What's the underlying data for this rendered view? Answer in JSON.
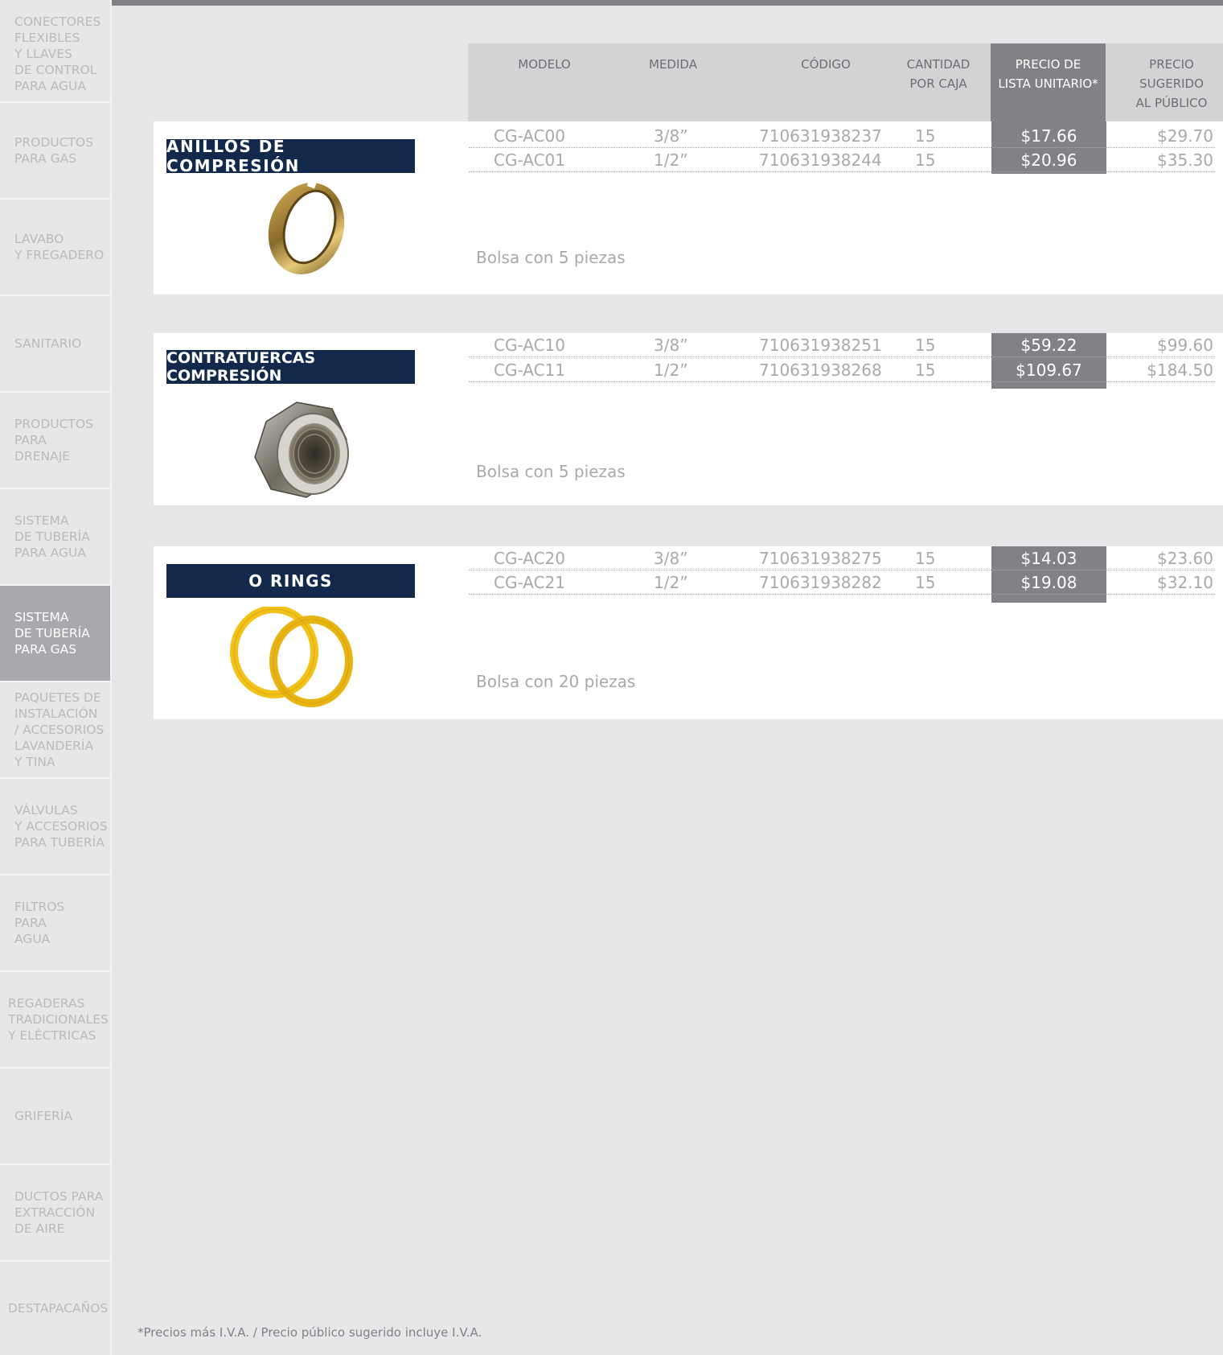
{
  "sidebar": {
    "items": [
      {
        "label": "CONECTORES\nFLEXIBLES\nY LLAVES\nDE CONTROL\nPARA AGUA"
      },
      {
        "label": "PRODUCTOS\nPARA GAS"
      },
      {
        "label": "LAVABO\nY FREGADERO"
      },
      {
        "label": "SANITARIO"
      },
      {
        "label": "PRODUCTOS\nPARA\nDRENAJE"
      },
      {
        "label": "SISTEMA\nDE TUBERÍA\nPARA AGUA"
      },
      {
        "label": "SISTEMA\nDE TUBERÍA\nPARA GAS"
      },
      {
        "label": "PAQUETES DE\nINSTALACIÓN\n/ ACCESORIOS\nLAVANDERÍA\nY TINA"
      },
      {
        "label": "VÁLVULAS\nY ACCESORIOS\nPARA TUBERÍA"
      },
      {
        "label": "FILTROS\nPARA\nAGUA"
      },
      {
        "label": "REGADERAS\nTRADICIONALES\nY ELÉCTRICAS"
      },
      {
        "label": "GRIFERÍA"
      },
      {
        "label": "DUCTOS PARA\nEXTRACCIÓN\nDE AIRE"
      },
      {
        "label": "DESTAPACAÑOS"
      }
    ],
    "active_index": 6
  },
  "table_header": {
    "modelo": "MODELO",
    "medida": "MEDIDA",
    "codigo": "CÓDIGO",
    "cantidad": "CANTIDAD\nPOR CAJA",
    "precio_lista": "PRECIO DE\nLISTA UNITARIO*",
    "precio_sugerido": "PRECIO\nSUGERIDO\nAL PÚBLICO"
  },
  "sections": [
    {
      "title": "ANILLOS DE COMPRESIÓN",
      "image": "brass-compression-ring",
      "rows": [
        {
          "modelo": "CG-AC00",
          "medida": "3/8”",
          "codigo": "710631938237",
          "cantidad": "15",
          "precio": "$17.66",
          "sugerido": "$29.70"
        },
        {
          "modelo": "CG-AC01",
          "medida": "1/2”",
          "codigo": "710631938244",
          "cantidad": "15",
          "precio": "$20.96",
          "sugerido": "$35.30"
        }
      ],
      "note": "Bolsa con 5 piezas"
    },
    {
      "title": "CONTRATUERCAS COMPRESIÓN",
      "image": "hex-compression-nut",
      "rows": [
        {
          "modelo": "CG-AC10",
          "medida": "3/8”",
          "codigo": "710631938251",
          "cantidad": "15",
          "precio": "$59.22",
          "sugerido": "$99.60"
        },
        {
          "modelo": "CG-AC11",
          "medida": "1/2”",
          "codigo": "710631938268",
          "cantidad": "15",
          "precio": "$109.67",
          "sugerido": "$184.50"
        }
      ],
      "note": "Bolsa con 5 piezas"
    },
    {
      "title": "O RINGS",
      "image": "yellow-o-rings",
      "rows": [
        {
          "modelo": "CG-AC20",
          "medida": "3/8”",
          "codigo": "710631938275",
          "cantidad": "15",
          "precio": "$14.03",
          "sugerido": "$23.60"
        },
        {
          "modelo": "CG-AC21",
          "medida": "1/2”",
          "codigo": "710631938282",
          "cantidad": "15",
          "precio": "$19.08",
          "sugerido": "$32.10"
        }
      ],
      "note": "Bolsa con 20 piezas"
    }
  ],
  "footnote": "*Precios más I.V.A. / Precio público sugerido incluye I.V.A.",
  "colors": {
    "navy": "#13294b",
    "dark_gray": "#808285",
    "light_gray": "#d1d3d4",
    "background": "#e6e7e8",
    "text_gray": "#a7a9ac",
    "ring_gold": "#f2c21a"
  }
}
